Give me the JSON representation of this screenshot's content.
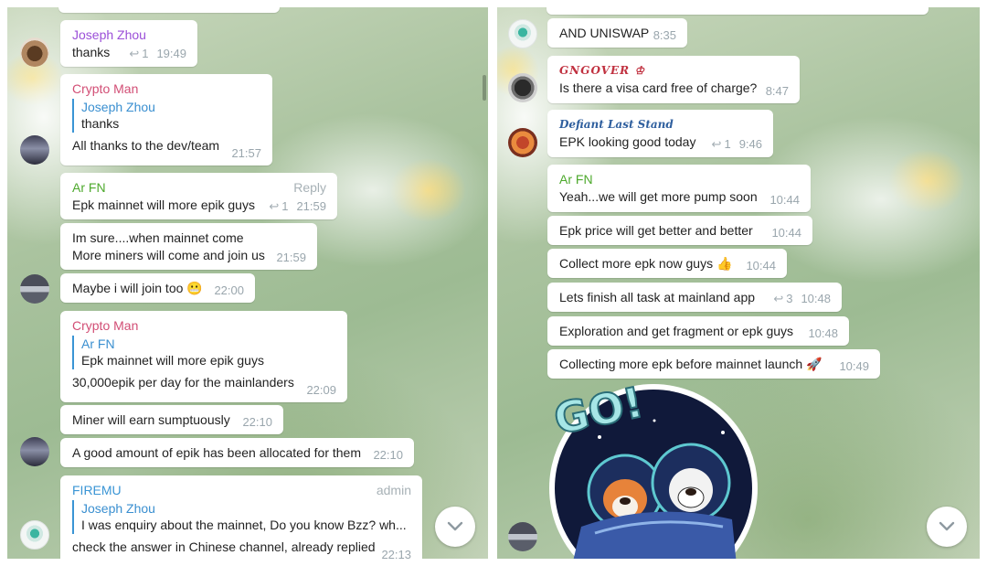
{
  "colors": {
    "name_purple": "#9b4fd8",
    "name_pink": "#d24e75",
    "name_green": "#4da92c",
    "name_blue": "#3a95d5",
    "name_darkred": "#c0303f",
    "name_navy": "#2f5f9e",
    "timestamp": "#9aa6ad",
    "bubble": "#ffffff"
  },
  "left_panel": {
    "messages": [
      {
        "sender": "Joseph Zhou",
        "text": "thanks",
        "reply_count": "1",
        "time": "19:49"
      },
      {
        "sender": "Crypto Man",
        "quote_name": "Joseph Zhou",
        "quote_text": "thanks",
        "text": "All thanks to the dev/team",
        "time": "21:57"
      },
      {
        "sender": "Ar FN",
        "action": "Reply",
        "text": "Epk mainnet will more epik guys",
        "reply_count": "1",
        "time": "21:59"
      },
      {
        "text_line1": "Im sure....when mainnet come",
        "text_line2": "More miners will come and join us",
        "time": "21:59"
      },
      {
        "text": "Maybe i will join too 😬",
        "time": "22:00"
      },
      {
        "sender": "Crypto Man",
        "quote_name": "Ar FN",
        "quote_text": "Epk mainnet will more epik guys",
        "text": "30,000epik  per day for the mainlanders",
        "time": "22:09"
      },
      {
        "text": "Miner will earn sumptuously",
        "time": "22:10"
      },
      {
        "text": "A good amount of epik has been allocated for them",
        "time": "22:10"
      },
      {
        "sender": "FIREMU",
        "tag": "admin",
        "quote_name": "Joseph Zhou",
        "quote_text": "I was enquiry about the mainnet,  Do you know Bzz?   wh...",
        "text": "check the answer in Chinese channel, already replied",
        "time": "22:13"
      }
    ],
    "scroll_button_icon": "chevron-down-icon"
  },
  "right_panel": {
    "messages": [
      {
        "text": "AND UNISWAP",
        "time": "8:35"
      },
      {
        "sender": "GNGOVER ♔",
        "text": "Is there a visa card free of charge?",
        "time": "8:47"
      },
      {
        "sender": "Defiant Last Stand",
        "text": "EPK looking good today",
        "reply_count": "1",
        "time": "9:46"
      },
      {
        "sender": "Ar FN",
        "text": "Yeah...we will get more pump soon",
        "time": "10:44"
      },
      {
        "text": "Epk price will get better and better",
        "time": "10:44"
      },
      {
        "text": "Collect more epk now guys 👍",
        "time": "10:44"
      },
      {
        "text": "Lets finish all task at mainland app",
        "reply_count": "3",
        "time": "10:48"
      },
      {
        "text": "Exploration and get fragment or epk guys",
        "time": "10:48"
      },
      {
        "text": "Collecting more epk before mainnet launch 🚀",
        "time": "10:49"
      }
    ],
    "sticker_text": "GO!",
    "scroll_button_icon": "chevron-down-icon"
  }
}
